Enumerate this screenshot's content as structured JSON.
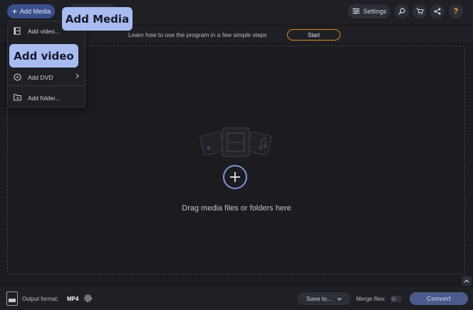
{
  "toolbar": {
    "add_media_label": "Add Media",
    "settings_label": "Settings",
    "help_label": "?"
  },
  "banner": {
    "text": "Learn how to use the program in a few simple steps",
    "start_label": "Start"
  },
  "dropzone": {
    "text": "Drag media files or folders here",
    "add_symbol": "+"
  },
  "menu": {
    "items": [
      {
        "label": "Add video...",
        "icon": "video-file-icon"
      },
      {
        "label": "Add DVD",
        "icon": "dvd-icon",
        "has_submenu": true
      },
      {
        "label": "Add folder...",
        "icon": "folder-icon"
      }
    ]
  },
  "callouts": {
    "add_media": "Add Media",
    "add_video": "Add video"
  },
  "bottom": {
    "output_format_label": "Output format:",
    "output_format_value": "MP4",
    "save_label": "Save to...",
    "merge_label": "Merge files:",
    "merge_on": false,
    "convert_label": "Convert"
  },
  "colors": {
    "background": "#1b1b20",
    "accent": "#3b4f8a",
    "start_border": "#e08a1e",
    "callout": "#a8bcf2",
    "help": "#f0b429"
  }
}
